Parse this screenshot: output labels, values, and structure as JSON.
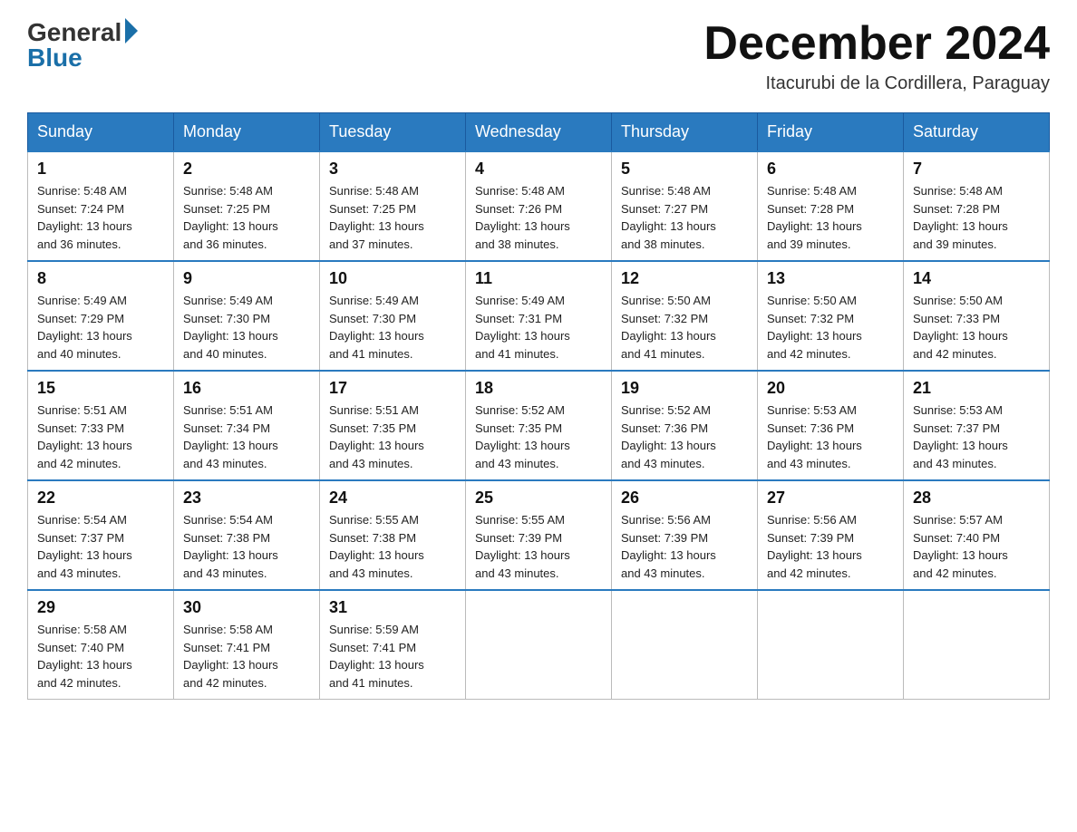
{
  "header": {
    "logo_general": "General",
    "logo_blue": "Blue",
    "month_title": "December 2024",
    "location": "Itacurubi de la Cordillera, Paraguay"
  },
  "days_of_week": [
    "Sunday",
    "Monday",
    "Tuesday",
    "Wednesday",
    "Thursday",
    "Friday",
    "Saturday"
  ],
  "weeks": [
    [
      {
        "day": "1",
        "sunrise": "5:48 AM",
        "sunset": "7:24 PM",
        "daylight": "13 hours and 36 minutes."
      },
      {
        "day": "2",
        "sunrise": "5:48 AM",
        "sunset": "7:25 PM",
        "daylight": "13 hours and 36 minutes."
      },
      {
        "day": "3",
        "sunrise": "5:48 AM",
        "sunset": "7:25 PM",
        "daylight": "13 hours and 37 minutes."
      },
      {
        "day": "4",
        "sunrise": "5:48 AM",
        "sunset": "7:26 PM",
        "daylight": "13 hours and 38 minutes."
      },
      {
        "day": "5",
        "sunrise": "5:48 AM",
        "sunset": "7:27 PM",
        "daylight": "13 hours and 38 minutes."
      },
      {
        "day": "6",
        "sunrise": "5:48 AM",
        "sunset": "7:28 PM",
        "daylight": "13 hours and 39 minutes."
      },
      {
        "day": "7",
        "sunrise": "5:48 AM",
        "sunset": "7:28 PM",
        "daylight": "13 hours and 39 minutes."
      }
    ],
    [
      {
        "day": "8",
        "sunrise": "5:49 AM",
        "sunset": "7:29 PM",
        "daylight": "13 hours and 40 minutes."
      },
      {
        "day": "9",
        "sunrise": "5:49 AM",
        "sunset": "7:30 PM",
        "daylight": "13 hours and 40 minutes."
      },
      {
        "day": "10",
        "sunrise": "5:49 AM",
        "sunset": "7:30 PM",
        "daylight": "13 hours and 41 minutes."
      },
      {
        "day": "11",
        "sunrise": "5:49 AM",
        "sunset": "7:31 PM",
        "daylight": "13 hours and 41 minutes."
      },
      {
        "day": "12",
        "sunrise": "5:50 AM",
        "sunset": "7:32 PM",
        "daylight": "13 hours and 41 minutes."
      },
      {
        "day": "13",
        "sunrise": "5:50 AM",
        "sunset": "7:32 PM",
        "daylight": "13 hours and 42 minutes."
      },
      {
        "day": "14",
        "sunrise": "5:50 AM",
        "sunset": "7:33 PM",
        "daylight": "13 hours and 42 minutes."
      }
    ],
    [
      {
        "day": "15",
        "sunrise": "5:51 AM",
        "sunset": "7:33 PM",
        "daylight": "13 hours and 42 minutes."
      },
      {
        "day": "16",
        "sunrise": "5:51 AM",
        "sunset": "7:34 PM",
        "daylight": "13 hours and 43 minutes."
      },
      {
        "day": "17",
        "sunrise": "5:51 AM",
        "sunset": "7:35 PM",
        "daylight": "13 hours and 43 minutes."
      },
      {
        "day": "18",
        "sunrise": "5:52 AM",
        "sunset": "7:35 PM",
        "daylight": "13 hours and 43 minutes."
      },
      {
        "day": "19",
        "sunrise": "5:52 AM",
        "sunset": "7:36 PM",
        "daylight": "13 hours and 43 minutes."
      },
      {
        "day": "20",
        "sunrise": "5:53 AM",
        "sunset": "7:36 PM",
        "daylight": "13 hours and 43 minutes."
      },
      {
        "day": "21",
        "sunrise": "5:53 AM",
        "sunset": "7:37 PM",
        "daylight": "13 hours and 43 minutes."
      }
    ],
    [
      {
        "day": "22",
        "sunrise": "5:54 AM",
        "sunset": "7:37 PM",
        "daylight": "13 hours and 43 minutes."
      },
      {
        "day": "23",
        "sunrise": "5:54 AM",
        "sunset": "7:38 PM",
        "daylight": "13 hours and 43 minutes."
      },
      {
        "day": "24",
        "sunrise": "5:55 AM",
        "sunset": "7:38 PM",
        "daylight": "13 hours and 43 minutes."
      },
      {
        "day": "25",
        "sunrise": "5:55 AM",
        "sunset": "7:39 PM",
        "daylight": "13 hours and 43 minutes."
      },
      {
        "day": "26",
        "sunrise": "5:56 AM",
        "sunset": "7:39 PM",
        "daylight": "13 hours and 43 minutes."
      },
      {
        "day": "27",
        "sunrise": "5:56 AM",
        "sunset": "7:39 PM",
        "daylight": "13 hours and 42 minutes."
      },
      {
        "day": "28",
        "sunrise": "5:57 AM",
        "sunset": "7:40 PM",
        "daylight": "13 hours and 42 minutes."
      }
    ],
    [
      {
        "day": "29",
        "sunrise": "5:58 AM",
        "sunset": "7:40 PM",
        "daylight": "13 hours and 42 minutes."
      },
      {
        "day": "30",
        "sunrise": "5:58 AM",
        "sunset": "7:41 PM",
        "daylight": "13 hours and 42 minutes."
      },
      {
        "day": "31",
        "sunrise": "5:59 AM",
        "sunset": "7:41 PM",
        "daylight": "13 hours and 41 minutes."
      },
      null,
      null,
      null,
      null
    ]
  ],
  "labels": {
    "sunrise": "Sunrise:",
    "sunset": "Sunset:",
    "daylight": "Daylight:"
  }
}
